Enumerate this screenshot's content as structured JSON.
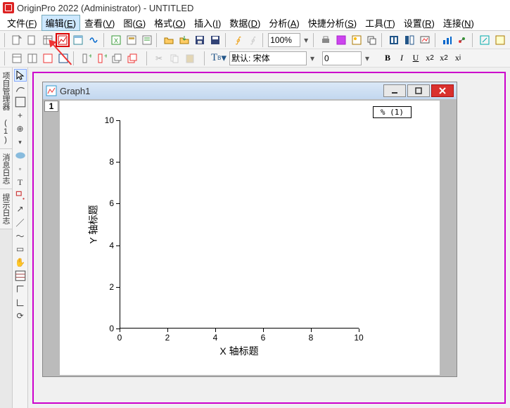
{
  "app": {
    "title": "OriginPro 2022 (Administrator) - UNTITLED"
  },
  "menu": {
    "items": [
      {
        "label": "文件",
        "key": "F"
      },
      {
        "label": "编辑",
        "key": "E",
        "selected": true
      },
      {
        "label": "查看",
        "key": "V"
      },
      {
        "label": "图",
        "key": "G"
      },
      {
        "label": "格式",
        "key": "O"
      },
      {
        "label": "插入",
        "key": "I"
      },
      {
        "label": "数据",
        "key": "D"
      },
      {
        "label": "分析",
        "key": "A"
      },
      {
        "label": "快捷分析",
        "key": "S"
      },
      {
        "label": "工具",
        "key": "T"
      },
      {
        "label": "设置",
        "key": "R"
      },
      {
        "label": "连接",
        "key": "N"
      }
    ]
  },
  "toolbar1": {
    "zoom": "100%",
    "icons": [
      "new-project",
      "new-folder",
      "new-workbook",
      "new-graph",
      "new-matrix",
      "new-excel",
      "new-notes",
      "new-layout",
      "new-function",
      "open",
      "save-template",
      "save",
      "save-project",
      "recalc",
      "lock",
      "print",
      "print-preview",
      "page-setup",
      "image",
      "duplicate",
      "import-wizard",
      "import",
      "refresh",
      "slideshow",
      "batch",
      "gallery"
    ]
  },
  "toolbar2": {
    "font_label": "默认: 宋体",
    "font_size": "0",
    "format_buttons": [
      "B",
      "I",
      "U",
      "x²",
      "x₂",
      "xᵢ"
    ]
  },
  "side_tabs": [
    "项目管理器 (1)",
    "消息日志",
    "提示日志"
  ],
  "palette_tools": [
    "pointer",
    "draw",
    "zoom",
    "data-reader",
    "screen-reader",
    "scale",
    "pan",
    "region",
    "enlarge",
    "text",
    "rect",
    "line",
    "arrow",
    "curve",
    "freehand",
    "hand",
    "rescale",
    "add-data",
    "mask",
    "3d"
  ],
  "graph_window": {
    "title": "Graph1",
    "tab": "1",
    "legend": "% (1)"
  },
  "chart_data": {
    "type": "scatter",
    "series": [],
    "xlabel": "X 轴标题",
    "ylabel": "Y 轴标题",
    "xlim": [
      0,
      10
    ],
    "ylim": [
      0,
      10
    ],
    "xticks": [
      0,
      2,
      4,
      6,
      8,
      10
    ],
    "yticks": [
      0,
      2,
      4,
      6,
      8,
      10
    ]
  }
}
